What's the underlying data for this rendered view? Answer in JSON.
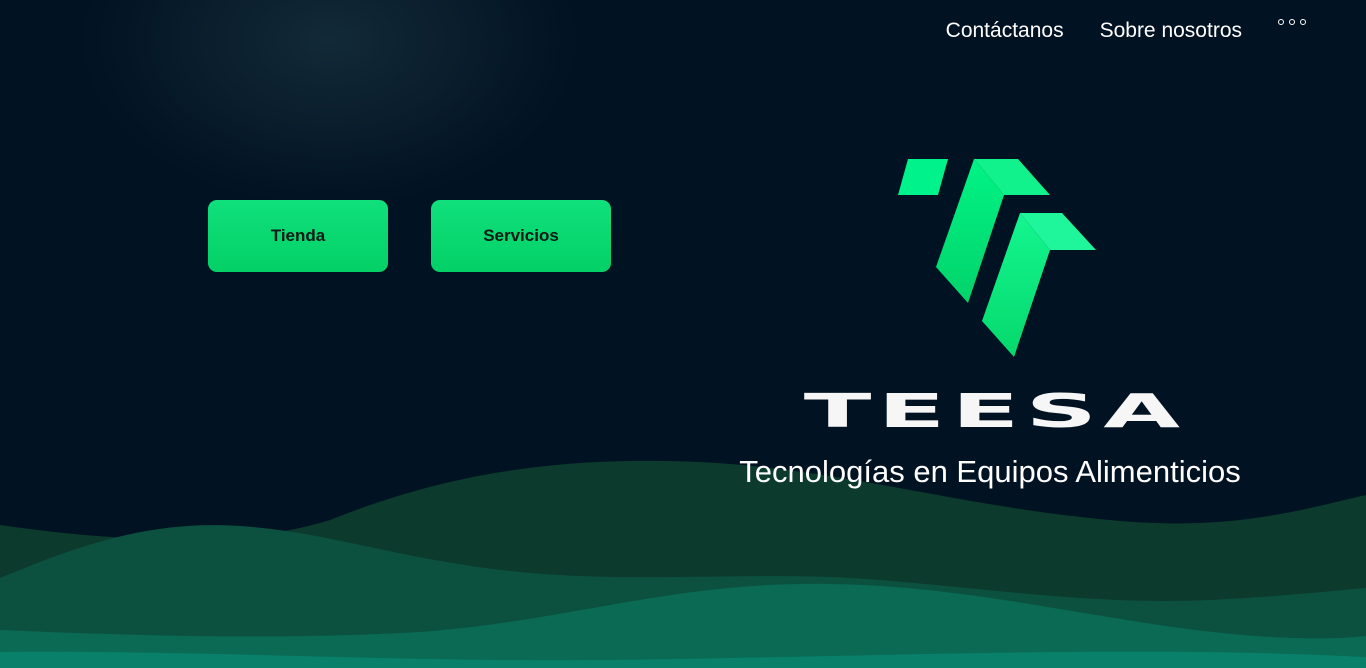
{
  "nav": {
    "contact_label": "Contáctanos",
    "about_label": "Sobre nosotros",
    "more_icon": "three-dots-icon"
  },
  "hero": {
    "buttons": {
      "store_label": "Tienda",
      "services_label": "Servicios"
    },
    "brand_name": "TEESA",
    "tagline": "Tecnologías en Equipos Alimenticios"
  },
  "colors": {
    "background": "#011222",
    "accent_green": "#03d167",
    "logo_green": "#00f07e",
    "wave_dark": "#0d3a2d",
    "wave_mid": "#0d5a48",
    "wave_light": "#0a7a62",
    "text": "#ffffff"
  }
}
